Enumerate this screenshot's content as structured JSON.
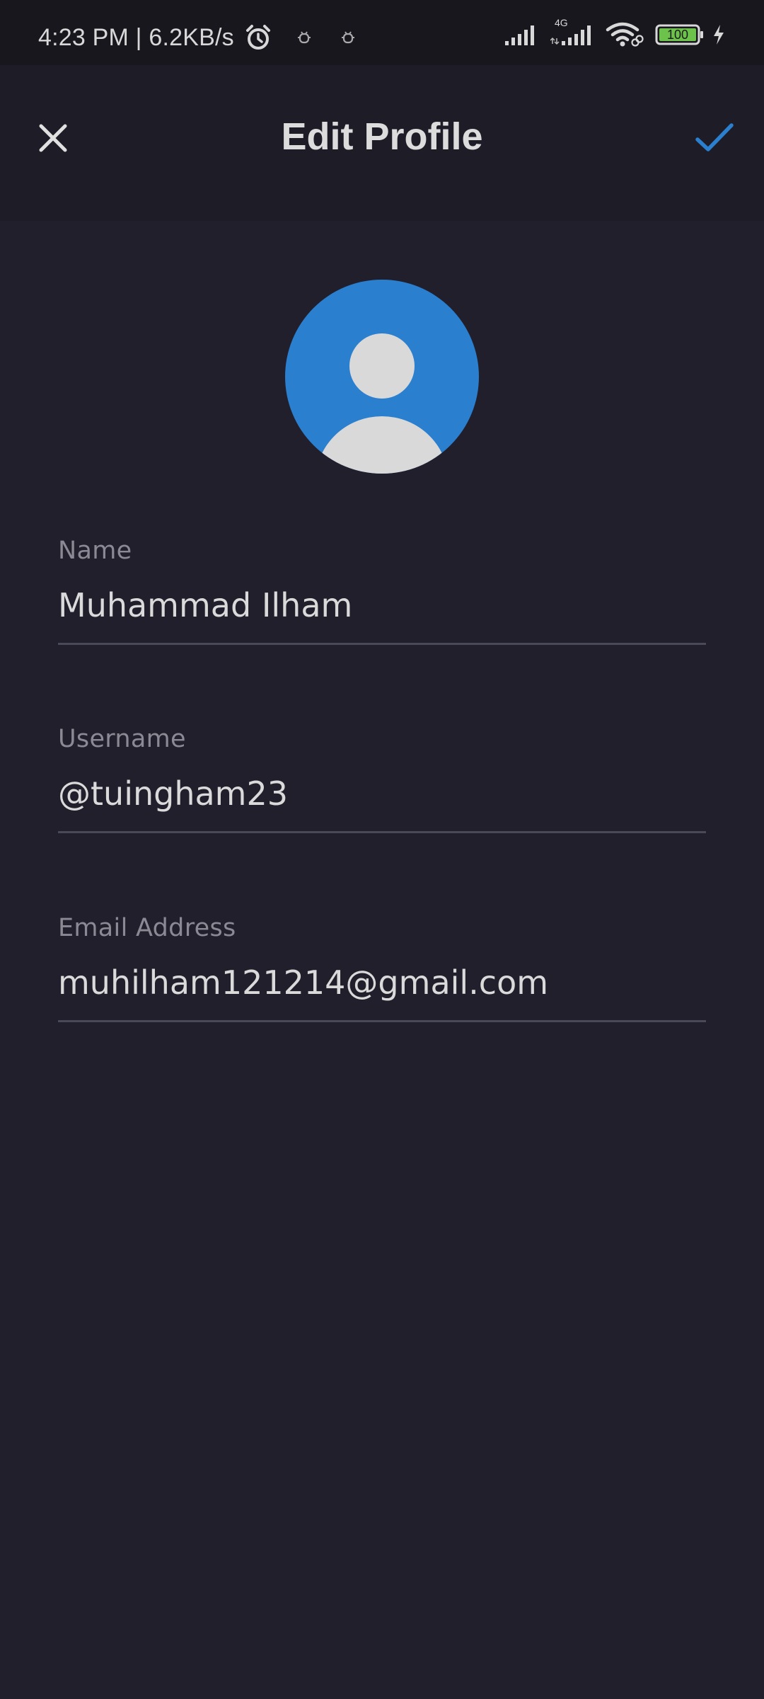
{
  "status_bar": {
    "time_text": "4:23 PM | 6.2KB/s",
    "network_type": "4G",
    "battery_level": "100",
    "icons": [
      "alarm-icon",
      "debug-icon",
      "debug-icon",
      "signal-icon",
      "signal-4g-icon",
      "wifi-icon",
      "battery-icon",
      "charging-icon"
    ]
  },
  "app_bar": {
    "title": "Edit Profile",
    "close_icon": "close-icon",
    "confirm_icon": "check-icon"
  },
  "colors": {
    "background": "#211f2c",
    "accent": "#2a7fce",
    "battery_green": "#6cc24a"
  },
  "profile": {
    "avatar_icon": "person-placeholder-icon"
  },
  "form": {
    "name": {
      "label": "Name",
      "value": "Muhammad Ilham"
    },
    "username": {
      "label": "Username",
      "value": "@tuingham23"
    },
    "email": {
      "label": "Email Address",
      "value": "muhilham121214@gmail.com"
    }
  }
}
